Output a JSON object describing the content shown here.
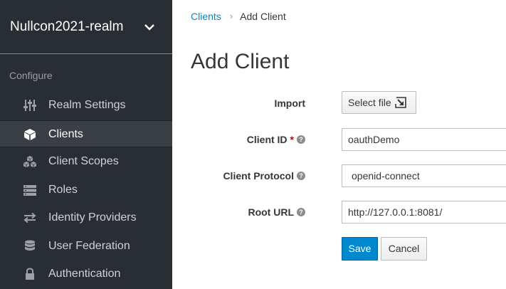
{
  "sidebar": {
    "realm_name": "Nullcon2021-realm",
    "section_title": "Configure",
    "items": [
      {
        "label": "Realm Settings",
        "icon": "sliders-icon"
      },
      {
        "label": "Clients",
        "icon": "cube-icon",
        "active": true
      },
      {
        "label": "Client Scopes",
        "icon": "cubes-icon"
      },
      {
        "label": "Roles",
        "icon": "list-icon"
      },
      {
        "label": "Identity Providers",
        "icon": "exchange-icon"
      },
      {
        "label": "User Federation",
        "icon": "database-icon"
      },
      {
        "label": "Authentication",
        "icon": "lock-icon"
      }
    ]
  },
  "breadcrumb": {
    "parent": "Clients",
    "separator": "›",
    "current": "Add Client"
  },
  "page": {
    "title": "Add Client"
  },
  "form": {
    "import_label": "Import",
    "select_file_label": "Select file",
    "client_id_label": "Client ID",
    "required_marker": "*",
    "client_id_value": "oauthDemo",
    "client_protocol_label": "Client Protocol",
    "client_protocol_value": "openid-connect",
    "root_url_label": "Root URL",
    "root_url_value": "http://127.0.0.1:8081/",
    "help_glyph": "?",
    "save_label": "Save",
    "cancel_label": "Cancel"
  },
  "colors": {
    "sidebar_bg": "#292e34",
    "accent": "#0088ce",
    "required": "#cc0000"
  }
}
